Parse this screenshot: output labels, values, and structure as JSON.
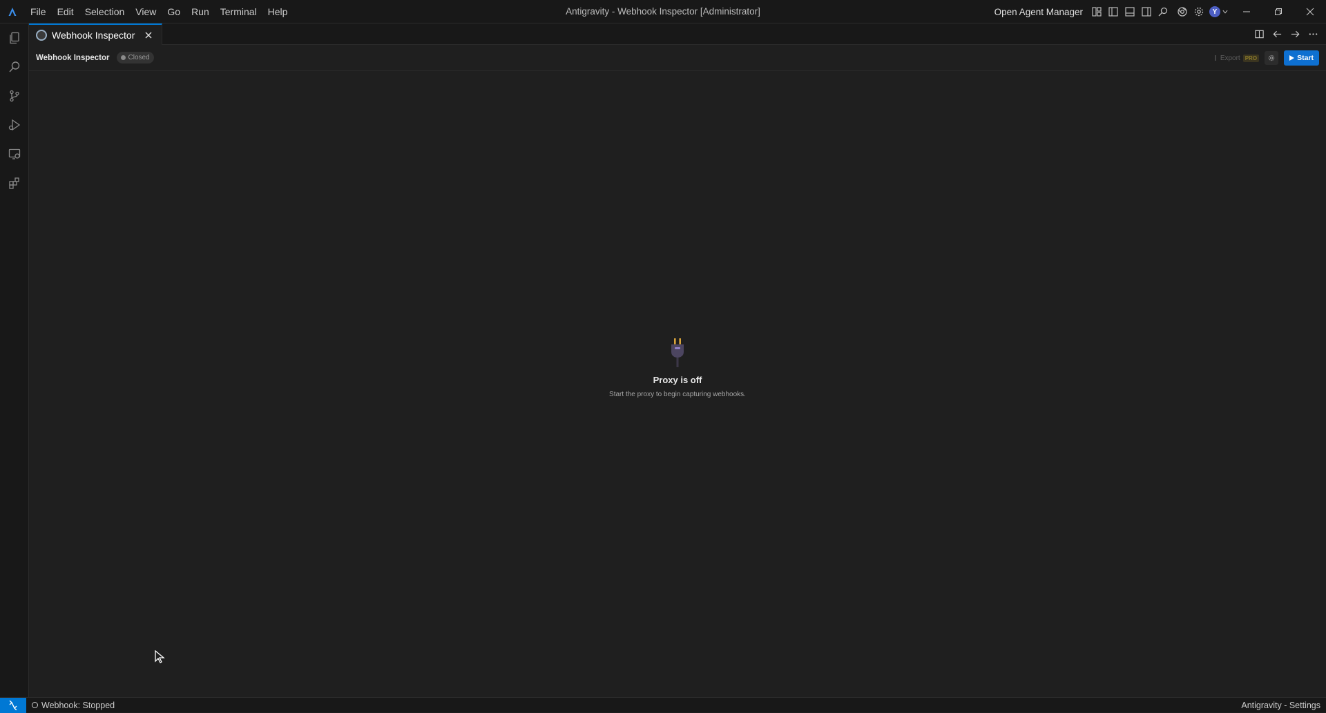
{
  "window": {
    "title": "Antigravity - Webhook Inspector [Administrator]",
    "agent_manager_label": "Open Agent Manager",
    "avatar_initial": "Y"
  },
  "menu": {
    "items": [
      "File",
      "Edit",
      "Selection",
      "View",
      "Go",
      "Run",
      "Terminal",
      "Help"
    ]
  },
  "tab": {
    "label": "Webhook Inspector"
  },
  "inspector": {
    "title": "Webhook Inspector",
    "status": "Closed",
    "export_label": "Export",
    "pro_badge": "PRO",
    "start_label": "Start"
  },
  "empty_state": {
    "title": "Proxy is off",
    "subtitle": "Start the proxy to begin capturing webhooks."
  },
  "statusbar": {
    "webhook_status": "Webhook: Stopped",
    "right_label": "Antigravity - Settings"
  },
  "colors": {
    "accent": "#0078d4",
    "start_button": "#0e70d1",
    "background": "#1f1f1f",
    "chrome": "#181818"
  }
}
